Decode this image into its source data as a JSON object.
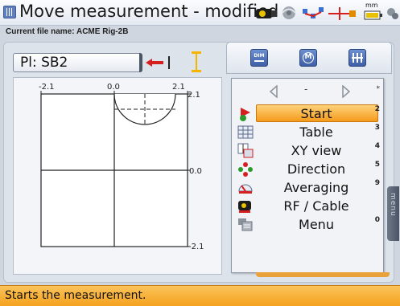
{
  "window": {
    "title": "Move measurement - modified",
    "file_label": "Current file name: ACME Rig-2B"
  },
  "status_icons": [
    "camera-icon",
    "sensor-icon",
    "network-icon",
    "laser-icon",
    "battery-icon",
    "units-icon"
  ],
  "units_label": "mm",
  "plane_selector": {
    "value": "Pl: SB2"
  },
  "chart": {
    "x_ticks": [
      "-2.1",
      "0.0",
      "2.1"
    ],
    "y_ticks": [
      "2.1",
      "0.0",
      "-2.1"
    ]
  },
  "toolbar": {
    "buttons": [
      "dim-button",
      "m-button",
      "keypad-button"
    ],
    "dim_label": "DIM",
    "m_label": "M"
  },
  "menu": {
    "nav_center": "-",
    "nav_key": "*",
    "items": [
      {
        "label": "Start",
        "key": "2",
        "icon": "start-flag-icon",
        "selected": true
      },
      {
        "label": "Table",
        "key": "3",
        "icon": "table-icon",
        "selected": false
      },
      {
        "label": "XY view",
        "key": "4",
        "icon": "xy-view-icon",
        "selected": false
      },
      {
        "label": "Direction",
        "key": "5",
        "icon": "direction-icon",
        "selected": false
      },
      {
        "label": "Averaging",
        "key": "9",
        "icon": "averaging-icon",
        "selected": false
      },
      {
        "label": "RF / Cable",
        "key": "",
        "icon": "rf-cable-icon",
        "selected": false
      },
      {
        "label": "Menu",
        "key": "0",
        "icon": "menu-icon",
        "selected": false
      }
    ],
    "side_tab": "menu"
  },
  "status_message": "Starts the measurement.",
  "colors": {
    "accent_orange": "#f59a1c",
    "status_bar": "#f4a21e",
    "arrow_red": "#d62020",
    "marker_yellow": "#f5b400"
  }
}
